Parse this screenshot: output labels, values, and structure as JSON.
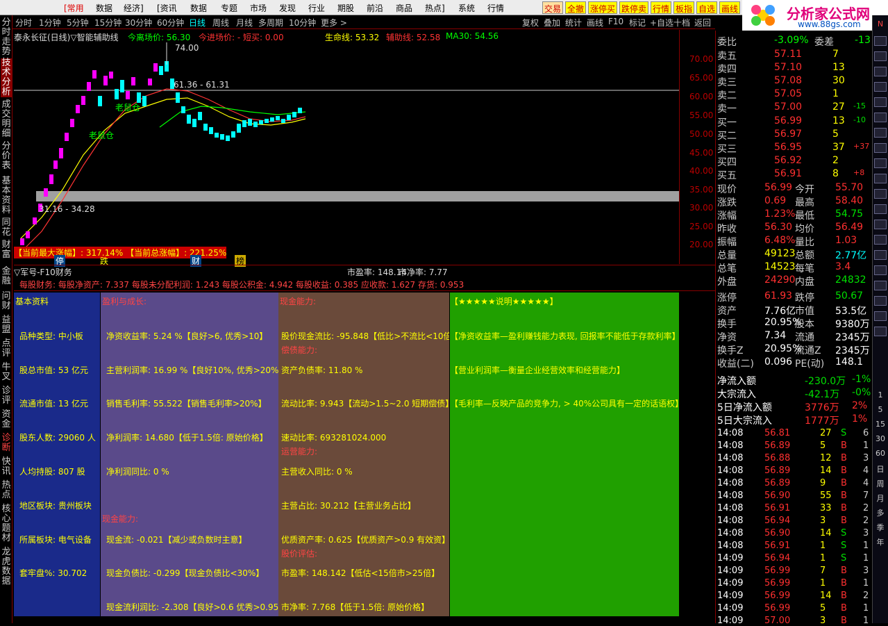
{
  "menu": {
    "items": [
      "[常用",
      "数据",
      "经济]",
      "[资讯",
      "数据",
      "专题",
      "市场",
      "发现",
      "行业",
      "期股",
      "前沿",
      "商品",
      "热点]",
      "系统",
      "行情"
    ],
    "quick": [
      "交易",
      "全撤",
      "涨停买",
      "跌停卖",
      "行情",
      "板指",
      "自选",
      "画线"
    ]
  },
  "logo": {
    "title": "分析家公式网",
    "url": "www.88gs.com"
  },
  "left_tabs": [
    "分时走势",
    "技术分析",
    "成交明细",
    "分价表",
    "基本资料",
    "同花",
    "财富",
    "金融",
    "问财",
    "益盟",
    "点评",
    "牛叉",
    "诊评",
    "资金",
    "诊断",
    "快讯",
    "热点",
    "核心题材",
    "龙虎数据"
  ],
  "toolbar": {
    "periods": [
      "分时",
      "1分钟",
      "5分钟",
      "15分钟",
      "30分钟",
      "60分钟",
      "日线",
      "周线",
      "月线",
      "多周期",
      "10分钟",
      "更多 >"
    ],
    "tools": [
      "复权",
      "叠加",
      "统计",
      "画线",
      "F10",
      "标记",
      "+自选",
      "十档",
      "返回"
    ]
  },
  "chart": {
    "title": "泰永长征(日线)▽智能辅助线",
    "exit_label": "今离场价: 56.30",
    "enter_label": "今进场价: - 短买: 0.00",
    "life_line": "生命线: 53.32",
    "assist_line": "辅助线: 52.58",
    "ma30": "MA30: 54.56",
    "high_mark": "74.00",
    "range_mark": "61.36 - 61.31",
    "low_range": "31.16 - 34.28",
    "annot1": "老鼠仓",
    "annot2": "老鼠仓",
    "banner": "【当前最大涨幅】: 317.14% 【当前总涨幅】: 221.25%",
    "badges": [
      "停",
      "跌",
      "财",
      "榜"
    ],
    "yaxis": [
      "70.00",
      "65.00",
      "60.00",
      "55.00",
      "50.00",
      "45.00",
      "40.00",
      "35.00",
      "30.00",
      "25.00",
      "20.00"
    ]
  },
  "f10": {
    "title": "▽军号-F10财务",
    "pe": "市盈率: 148.14",
    "pb": "市净率: 7.77",
    "row": "每股财务: 每股净资产: 7.337 每股未分配利润: 1.243 每股公积金: 4.942 每股收益: 0.385 应收款: 1.627 存货: 0.953"
  },
  "col1": {
    "title": "基本资料",
    "items": [
      "品种类型: 中小板",
      "股总市值: 53 亿元",
      "流通市值: 13 亿元",
      "股东人数: 29060 人",
      "人均持股: 807 股",
      "地区板块: 贵州板块",
      "所属板块: 电气设备",
      "套牢盘%: 30.702"
    ]
  },
  "col2": {
    "title": "盈利与成长:",
    "items": [
      "净资收益率: 5.24 %【良好>6, 优秀>10】",
      "主营利润率: 16.99 %【良好10%, 优秀>20%】",
      "销售毛利率: 55.522【销售毛利率>20%】",
      "净利润率: 14.680【低于1.5倍: 原始价格】",
      "净利润同比: 0 %",
      "现金能力:",
      "现金流: -0.021【减少或负数时主意】",
      "现金负债比: -0.299【现金负债比<30%】",
      "现金流利润比: -2.308【良好>0.6 优秀>0.95】"
    ]
  },
  "col3": {
    "title": "现金能力:",
    "items": [
      "股价现金流比: -95.848【低比>不流比<10倍】",
      "偿债能力:",
      "资产负债率: 11.80 %",
      "流动比率: 9.943【流动>1.5~2.0 短期偿债】",
      "速动比率: 693281024.000",
      "运营能力:",
      "主营收入同比: 0 %",
      "主营占比: 30.212【主营业务占比】",
      "优质资产率: 0.625【优质资产>0.9 有效资】",
      "股价评估:",
      "市盈率: 148.142【低估<15倍市>25倍】",
      "市净率: 7.768【低于1.5倍: 原始价格】"
    ]
  },
  "col4": {
    "title": "【★★★★★说明★★★★★】",
    "items": [
      "【净资收益率—盈利赚钱能力表现, 回报率不能低于存款利率】",
      "【营业利润率—衡量企业经营效率和经营能力】",
      "【毛利率—反映产品的竞争力, > 40%公司具有一定的话语权】"
    ]
  },
  "right": {
    "header": [
      "委比",
      "-3.09%",
      "委差",
      "-13"
    ],
    "asks": [
      [
        "卖五",
        "57.11",
        "7",
        ""
      ],
      [
        "卖四",
        "57.10",
        "13",
        ""
      ],
      [
        "卖三",
        "57.08",
        "30",
        ""
      ],
      [
        "卖二",
        "57.05",
        "1",
        ""
      ],
      [
        "卖一",
        "57.00",
        "27",
        "-15"
      ]
    ],
    "bids": [
      [
        "买一",
        "56.99",
        "13",
        "-10"
      ],
      [
        "买二",
        "56.97",
        "5",
        ""
      ],
      [
        "买三",
        "56.95",
        "37",
        "+37"
      ],
      [
        "买四",
        "56.92",
        "2",
        ""
      ],
      [
        "买五",
        "56.91",
        "8",
        "+8"
      ]
    ],
    "stats": [
      [
        "现价",
        "56.99",
        "今开",
        "55.70"
      ],
      [
        "涨跌",
        "0.69",
        "最高",
        "58.40"
      ],
      [
        "涨幅",
        "1.23%",
        "最低",
        "54.75"
      ],
      [
        "昨收",
        "56.30",
        "均价",
        "56.49"
      ],
      [
        "振幅",
        "6.48%",
        "量比",
        "1.03"
      ],
      [
        "总量",
        "49123",
        "总额",
        "2.77亿"
      ],
      [
        "总笔",
        "14523",
        "每笔",
        "3.4"
      ],
      [
        "外盘",
        "24290",
        "内盘",
        "24832"
      ]
    ],
    "stats2": [
      [
        "涨停",
        "61.93",
        "跌停",
        "50.67"
      ],
      [
        "资产",
        "7.76亿",
        "市值",
        "53.5亿"
      ],
      [
        "换手",
        "20.95%",
        "股本",
        "9380万"
      ],
      [
        "净资",
        "7.34",
        "流通",
        "2345万"
      ],
      [
        "换手Z",
        "20.95%",
        "流通Z",
        "2345万"
      ],
      [
        "收益(二)",
        "0.096",
        "PE(动)",
        "148.1"
      ]
    ],
    "flows": [
      [
        "净流入额",
        "-230.0万",
        "-1%"
      ],
      [
        "大宗流入",
        "-42.1万",
        "-0%"
      ],
      [
        "5日净流入额",
        "3776万",
        "2%"
      ],
      [
        "5日大宗流入",
        "1777万",
        "1%"
      ]
    ],
    "ticks": [
      [
        "14:08",
        "56.81",
        "27",
        "S",
        "6"
      ],
      [
        "14:08",
        "56.89",
        "5",
        "B",
        "1"
      ],
      [
        "14:08",
        "56.88",
        "12",
        "B",
        "3"
      ],
      [
        "14:08",
        "56.89",
        "14",
        "B",
        "4"
      ],
      [
        "14:08",
        "56.89",
        "9",
        "B",
        "4"
      ],
      [
        "14:08",
        "56.90",
        "55",
        "B",
        "7"
      ],
      [
        "14:08",
        "56.91",
        "33",
        "B",
        "2"
      ],
      [
        "14:08",
        "56.94",
        "3",
        "B",
        "2"
      ],
      [
        "14:08",
        "56.90",
        "14",
        "S",
        "3"
      ],
      [
        "14:08",
        "56.91",
        "1",
        "S",
        "1"
      ],
      [
        "14:09",
        "56.94",
        "1",
        "S",
        "1"
      ],
      [
        "14:09",
        "56.99",
        "7",
        "B",
        "3"
      ],
      [
        "14:09",
        "56.99",
        "1",
        "B",
        "1"
      ],
      [
        "14:09",
        "56.99",
        "14",
        "B",
        "2"
      ],
      [
        "14:09",
        "56.99",
        "5",
        "B",
        "1"
      ],
      [
        "14:09",
        "57.00",
        "3",
        "B",
        "1"
      ]
    ]
  },
  "rightbar": {
    "items": [
      "1",
      "5",
      "15",
      "30",
      "60",
      "日",
      "周",
      "月",
      "多",
      "季",
      "年"
    ]
  },
  "colors": {
    "red": "#ff3030",
    "green": "#00e000",
    "yellow": "#ffff00",
    "cyan": "#00ffff",
    "magenta": "#ff00ff"
  }
}
